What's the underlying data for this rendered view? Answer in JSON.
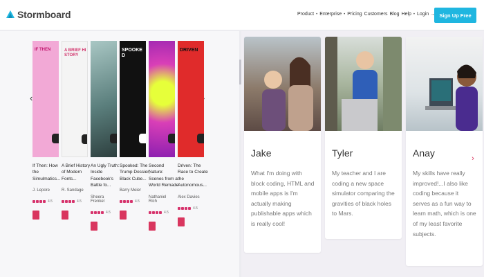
{
  "header": {
    "logo": "Stormboard",
    "nav": [
      {
        "label": "Product",
        "dot": true
      },
      {
        "label": "Enterprise",
        "dot": true
      },
      {
        "label": "Pricing",
        "dot": false
      },
      {
        "label": "Customers",
        "dot": false
      },
      {
        "label": "Blog",
        "dot": false
      },
      {
        "label": "Help",
        "dot": true
      },
      {
        "label": "Login →",
        "dot": false
      }
    ],
    "signup": "Sign Up Free"
  },
  "colors": {
    "accent": "#1fb6e0",
    "brand_pink": "#d9365f"
  },
  "books": [
    {
      "cover_text": "IF THEN",
      "cover_bg": "#f2a9d6",
      "title": "If Then: How the Simulmatics...",
      "author": "J. Lepore",
      "rating": "4.5"
    },
    {
      "cover_text": "A BRIEF HISTORY",
      "cover_bg": "#f4f4f4",
      "title": "A Brief History of Modern Fonts...",
      "author": "R. Sandage",
      "rating": "4.5"
    },
    {
      "cover_text": "",
      "cover_bg": "#7ea6a4",
      "title": "An Ugly Truth: Inside Facebook's Battle fo...",
      "author": "Sheera Frenkel",
      "rating": "4.5"
    },
    {
      "cover_text": "SPOOKED",
      "cover_bg": "#111111",
      "title": "Spooked: The Trump Dossier, Black Cube...",
      "author": "Barry Meier",
      "rating": "4.5"
    },
    {
      "cover_text": "",
      "cover_bg": "#d93fb7",
      "title": "Second Nature: Scenes from a World Remade",
      "author": "Nathaniel Rich",
      "rating": "4.5"
    },
    {
      "cover_text": "DRIVEN",
      "cover_bg": "#e02b2b",
      "title": "Driven: The Race to Create the Autonomous...",
      "author": "Alex Davies",
      "rating": "4.5"
    }
  ],
  "testimonials": [
    {
      "name": "Jake",
      "quote": "What I'm doing with block coding, HTML and mobile apps is I'm actually making publishable apps which is really cool!"
    },
    {
      "name": "Tyler",
      "quote": "My teacher and I are coding a new space simulator comparing the gravities of black holes to Mars."
    },
    {
      "name": "Anay",
      "quote": "My skills have really improved!...I also like coding because it serves as a fun way to learn math, which is one of my least favorite subjects."
    }
  ]
}
